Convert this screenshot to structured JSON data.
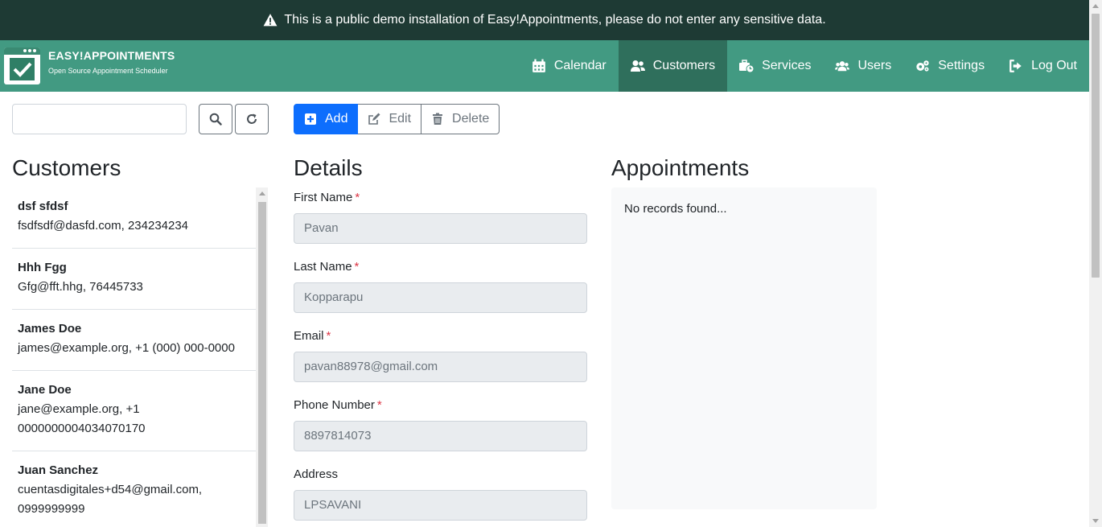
{
  "banner": {
    "text": "This is a public demo installation of Easy!Appointments, please do not enter any sensitive data."
  },
  "brand": {
    "title": "EASY!APPOINTMENTS",
    "subtitle": "Open Source Appointment Scheduler"
  },
  "nav": {
    "calendar": "Calendar",
    "customers": "Customers",
    "services": "Services",
    "users": "Users",
    "settings": "Settings",
    "logout": "Log Out"
  },
  "search": {
    "value": ""
  },
  "toolbar": {
    "add": "Add",
    "edit": "Edit",
    "delete": "Delete"
  },
  "customers": {
    "heading": "Customers",
    "items": [
      {
        "name": "dsf sfdsf",
        "info": "fsdfsdf@dasfd.com, 234234234"
      },
      {
        "name": "Hhh Fgg",
        "info": "Gfg@fft.hhg, 76445733"
      },
      {
        "name": "James Doe",
        "info": "james@example.org, +1 (000) 000-0000"
      },
      {
        "name": "Jane Doe",
        "info": "jane@example.org, +1 0000000004034070170"
      },
      {
        "name": "Juan Sanchez",
        "info": "cuentasdigitales+d54@gmail.com, 0999999999"
      }
    ]
  },
  "details": {
    "heading": "Details",
    "first_name": {
      "label": "First Name",
      "value": "Pavan"
    },
    "last_name": {
      "label": "Last Name",
      "value": "Kopparapu"
    },
    "email": {
      "label": "Email",
      "value": "pavan88978@gmail.com"
    },
    "phone": {
      "label": "Phone Number",
      "value": "8897814073"
    },
    "address": {
      "label": "Address",
      "value": "LPSAVANI"
    },
    "required_mark": "*"
  },
  "appointments": {
    "heading": "Appointments",
    "empty": "No records found..."
  },
  "colors": {
    "banner": "#1e3a34",
    "navbar": "#429a82",
    "nav_active": "#2f6f5c",
    "primary": "#0d6efd"
  }
}
